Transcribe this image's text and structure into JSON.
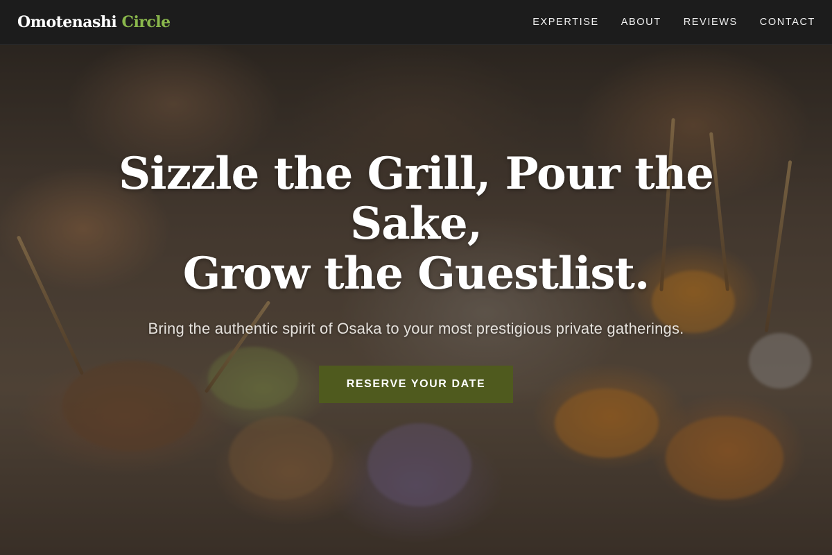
{
  "brand": {
    "name_primary": "Omotenashi",
    "name_accent": "Circle",
    "accent_color": "#8ab84c"
  },
  "nav": {
    "items": [
      {
        "label": "EXPERTISE"
      },
      {
        "label": "ABOUT"
      },
      {
        "label": "REVIEWS"
      },
      {
        "label": "CONTACT"
      }
    ]
  },
  "hero": {
    "headline_line1": "Sizzle the Grill, Pour the Sake,",
    "headline_line2": "Grow the Guestlist.",
    "subtitle": "Bring the authentic spirit of Osaka to your most prestigious private gatherings.",
    "cta_label": "RESERVE YOUR DATE",
    "cta_color": "#4f5a1e"
  }
}
